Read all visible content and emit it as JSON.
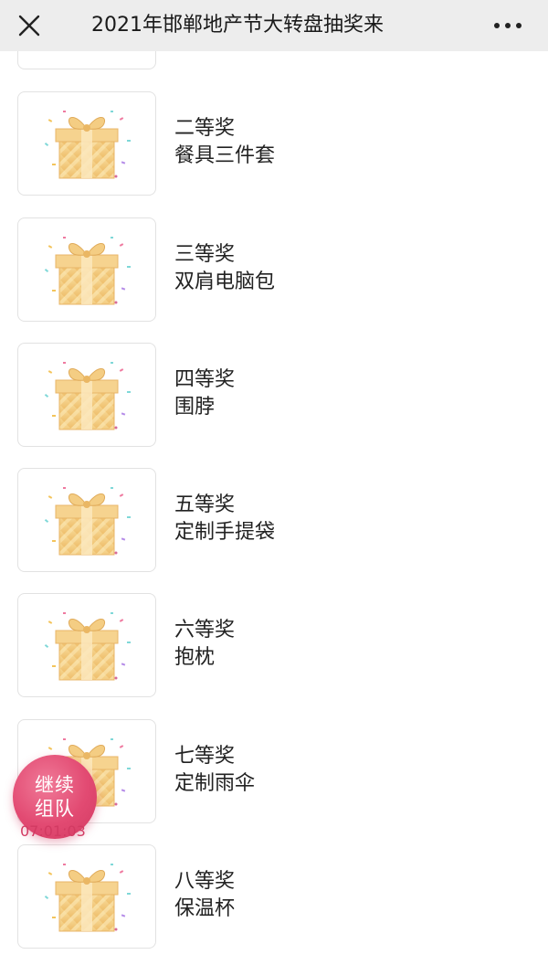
{
  "header": {
    "title": "2021年邯郸地产节大转盘抽奖来"
  },
  "prizes": [
    {
      "level": "二等奖",
      "name": "餐具三件套"
    },
    {
      "level": "三等奖",
      "name": "双肩电脑包"
    },
    {
      "level": "四等奖",
      "name": "围脖"
    },
    {
      "level": "五等奖",
      "name": "定制手提袋"
    },
    {
      "level": "六等奖",
      "name": "抱枕"
    },
    {
      "level": "七等奖",
      "name": "定制雨伞"
    },
    {
      "level": "八等奖",
      "name": "保温杯"
    }
  ],
  "badge": {
    "line1": "继续",
    "line2": "组队",
    "timer": "07:01:03"
  },
  "colors": {
    "header_bg": "#ededed",
    "badge": "#e24a72",
    "gift_gold": "#f2c879"
  }
}
